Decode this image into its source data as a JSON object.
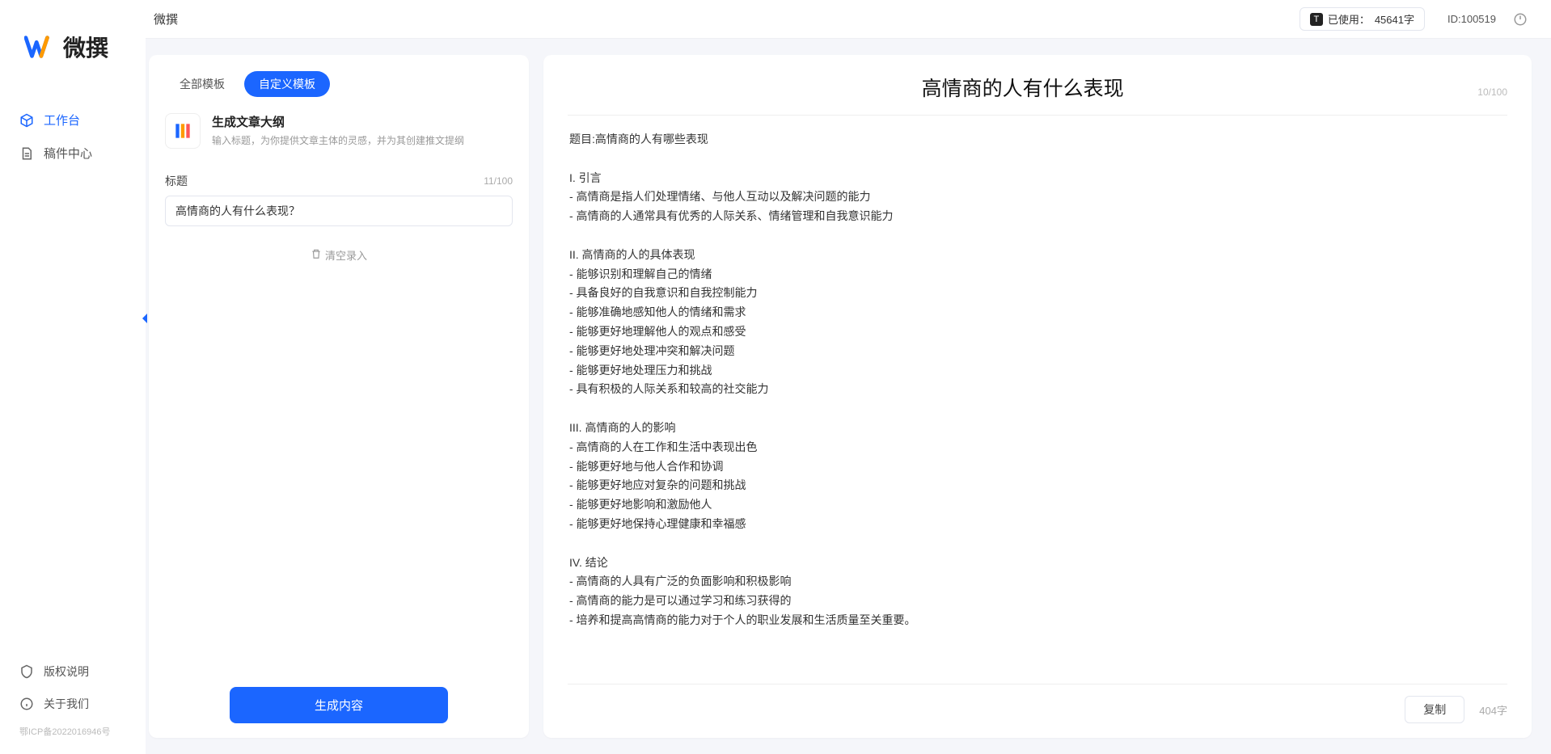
{
  "brand": {
    "name": "微撰"
  },
  "topbar": {
    "title": "微撰",
    "usage_prefix": "已使用：",
    "usage_value": "45641字",
    "id_prefix": "ID:",
    "id_value": "100519"
  },
  "sidebar": {
    "nav": [
      {
        "label": "工作台",
        "active": true
      },
      {
        "label": "稿件中心",
        "active": false
      }
    ],
    "bottom": [
      {
        "label": "版权说明"
      },
      {
        "label": "关于我们"
      }
    ],
    "icp": "鄂ICP备2022016946号"
  },
  "left_panel": {
    "tabs": [
      {
        "label": "全部模板",
        "active": false
      },
      {
        "label": "自定义模板",
        "active": true
      }
    ],
    "template": {
      "title": "生成文章大纲",
      "desc": "输入标题，为你提供文章主体的灵感，并为其创建推文提纲"
    },
    "field_label": "标题",
    "input_counter": "11/100",
    "input_value": "高情商的人有什么表现？",
    "clear_label": "清空录入",
    "generate_label": "生成内容"
  },
  "right_panel": {
    "title": "高情商的人有什么表现",
    "counter": "10/100",
    "body": "题目:高情商的人有哪些表现\n\nI. 引言\n- 高情商是指人们处理情绪、与他人互动以及解决问题的能力\n- 高情商的人通常具有优秀的人际关系、情绪管理和自我意识能力\n\nII. 高情商的人的具体表现\n- 能够识别和理解自己的情绪\n- 具备良好的自我意识和自我控制能力\n- 能够准确地感知他人的情绪和需求\n- 能够更好地理解他人的观点和感受\n- 能够更好地处理冲突和解决问题\n- 能够更好地处理压力和挑战\n- 具有积极的人际关系和较高的社交能力\n\nIII. 高情商的人的影响\n- 高情商的人在工作和生活中表现出色\n- 能够更好地与他人合作和协调\n- 能够更好地应对复杂的问题和挑战\n- 能够更好地影响和激励他人\n- 能够更好地保持心理健康和幸福感\n\nIV. 结论\n- 高情商的人具有广泛的负面影响和积极影响\n- 高情商的能力是可以通过学习和练习获得的\n- 培养和提高高情商的能力对于个人的职业发展和生活质量至关重要。",
    "copy_label": "复制",
    "word_count": "404字"
  }
}
